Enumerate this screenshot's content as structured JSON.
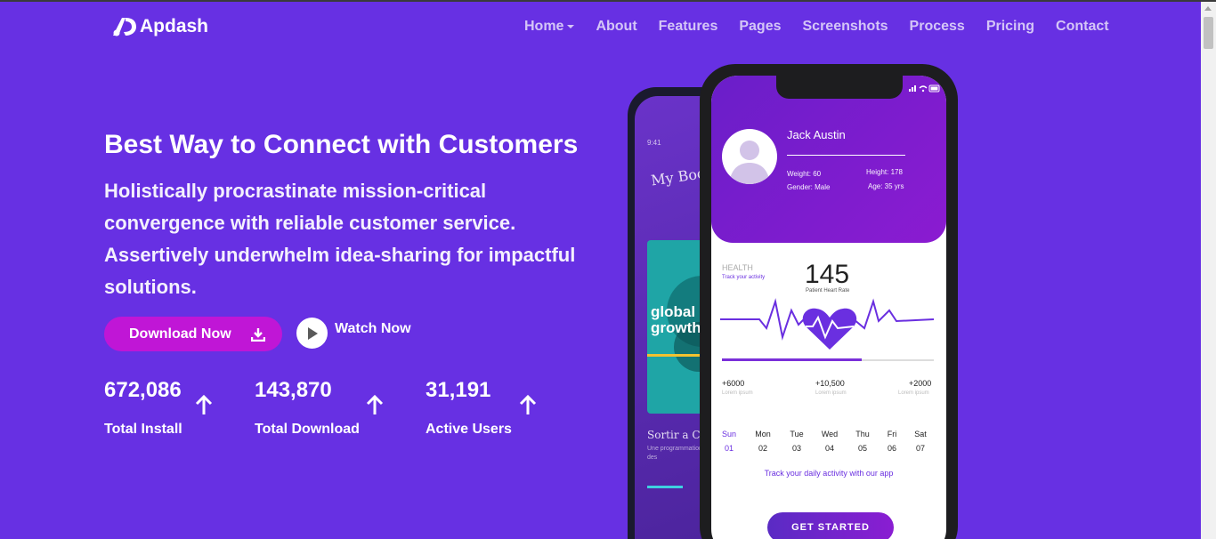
{
  "brand": {
    "name": "Apdash"
  },
  "nav": {
    "items": [
      "Home",
      "About",
      "Features",
      "Pages",
      "Screenshots",
      "Process",
      "Pricing",
      "Contact"
    ]
  },
  "hero": {
    "title": "Best Way to Connect with Customers",
    "description": "Holistically procrastinate mission-critical convergence with reliable customer service. Assertively underwhelm idea-sharing for impactful solutions.",
    "download_label": "Download Now",
    "watch_label": "Watch Now"
  },
  "stats": [
    {
      "value": "672,086",
      "label": "Total Install"
    },
    {
      "value": "143,870",
      "label": "Total Download"
    },
    {
      "value": "31,191",
      "label": "Active Users"
    }
  ],
  "phone": {
    "profile": {
      "name": "Jack Austin",
      "weight": "Weight: 60",
      "gender": "Gender: Male",
      "height": "Height: 178",
      "age": "Age: 35 yrs"
    },
    "health": {
      "label": "HEALTH",
      "track": "Track your activity",
      "value": "145",
      "value_label": "Patient Heart Rate",
      "progress": 0.66
    },
    "metrics": [
      {
        "value": "+6000",
        "sub": "Lorem ipsum"
      },
      {
        "value": "+10,500",
        "sub": "Lorem ipsum"
      },
      {
        "value": "+2000",
        "sub": "Lorem ipsum"
      }
    ],
    "days": [
      {
        "name": "Sun",
        "num": "01",
        "active": true
      },
      {
        "name": "Mon",
        "num": "02"
      },
      {
        "name": "Tue",
        "num": "03"
      },
      {
        "name": "Wed",
        "num": "04"
      },
      {
        "name": "Thu",
        "num": "05"
      },
      {
        "name": "Fri",
        "num": "06"
      },
      {
        "name": "Sat",
        "num": "07"
      }
    ],
    "track_text": "Track your daily activity with our app",
    "cta": "GET STARTED"
  },
  "back_phone": {
    "time": "9:41",
    "title": "My Books",
    "cover_text": "global growth",
    "caption": "Sortir a Cannes",
    "sub": "Une programmation festivals et des"
  },
  "colors": {
    "background": "#6730e3",
    "accent": "#c016d6",
    "phone_purple": "#6a2fe0"
  }
}
